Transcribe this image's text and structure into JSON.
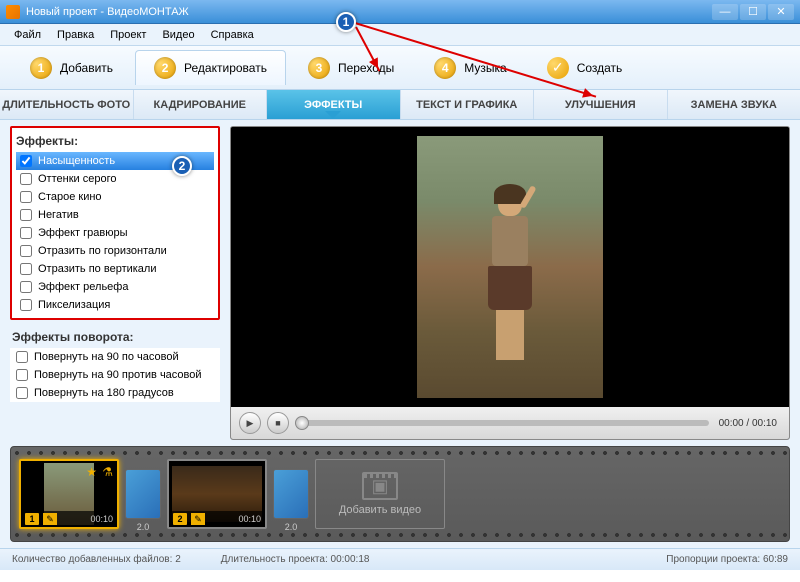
{
  "titlebar": {
    "title": "Новый проект - ВидеоМОНТАЖ"
  },
  "menubar": {
    "items": [
      "Файл",
      "Правка",
      "Проект",
      "Видео",
      "Справка"
    ]
  },
  "steps": {
    "items": [
      {
        "num": "1",
        "label": "Добавить"
      },
      {
        "num": "2",
        "label": "Редактировать"
      },
      {
        "num": "3",
        "label": "Переходы"
      },
      {
        "num": "4",
        "label": "Музыка"
      },
      {
        "num": "✓",
        "label": "Создать"
      }
    ],
    "active_index": 1
  },
  "subtabs": {
    "items": [
      "ДЛИТЕЛЬНОСТЬ ФОТО",
      "КАДРИРОВАНИЕ",
      "ЭФФЕКТЫ",
      "ТЕКСТ И ГРАФИКА",
      "УЛУЧШЕНИЯ",
      "ЗАМЕНА ЗВУКА"
    ],
    "active_index": 2
  },
  "sidebar": {
    "effects_title": "Эффекты:",
    "effects": [
      {
        "label": "Насыщенность",
        "checked": true,
        "selected": true
      },
      {
        "label": "Оттенки серого",
        "checked": false
      },
      {
        "label": "Старое кино",
        "checked": false
      },
      {
        "label": "Негатив",
        "checked": false
      },
      {
        "label": "Эффект гравюры",
        "checked": false
      },
      {
        "label": "Отразить по горизонтали",
        "checked": false
      },
      {
        "label": "Отразить по вертикали",
        "checked": false
      },
      {
        "label": "Эффект рельефа",
        "checked": false
      },
      {
        "label": "Пикселизация",
        "checked": false
      }
    ],
    "rotate_title": "Эффекты поворота:",
    "rotate": [
      {
        "label": "Повернуть на 90 по часовой",
        "checked": false
      },
      {
        "label": "Повернуть на 90 против часовой",
        "checked": false
      },
      {
        "label": "Повернуть на 180 градусов",
        "checked": false
      }
    ]
  },
  "controls": {
    "time_current": "00:00",
    "time_total": "00:10"
  },
  "timeline": {
    "clips": [
      {
        "num": "1",
        "dur": "00:10",
        "selected": true
      },
      {
        "num": "2",
        "dur": "00:10",
        "selected": false
      }
    ],
    "transition_dur": "2.0",
    "add_label": "Добавить видео"
  },
  "statusbar": {
    "files_label": "Количество добавленных файлов:",
    "files_count": "2",
    "duration_label": "Длительность проекта:",
    "duration_value": "00:00:18",
    "ratio_label": "Пропорции проекта:",
    "ratio_value": "60:89"
  },
  "annotations": {
    "n1": "1",
    "n2": "2"
  }
}
